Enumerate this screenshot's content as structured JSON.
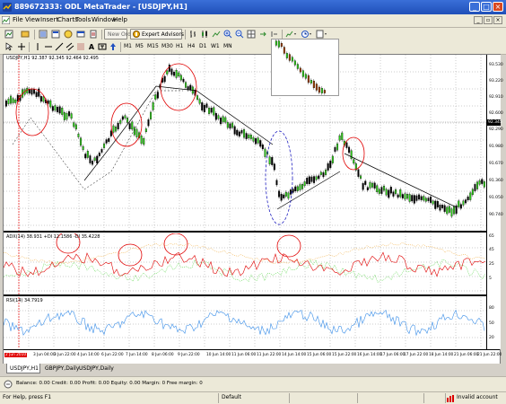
{
  "window": {
    "title": "889672333: ODL MetaTrader - [USDJPY,H1]",
    "buttons": [
      "_",
      "□",
      "×"
    ]
  },
  "menu": {
    "items": [
      "File",
      "View",
      "Insert",
      "Charts",
      "Tools",
      "Window",
      "Help"
    ]
  },
  "toolbar": {
    "new_order": "New Order",
    "expert_advisors": "Expert Advisors",
    "timeframes": [
      "M1",
      "M5",
      "M15",
      "M30",
      "H1",
      "H4",
      "D1",
      "W1",
      "MN"
    ]
  },
  "chart": {
    "main_label": "USDJPY,H1  92.387 92.345 92.464 92.495",
    "adx_label": "ADX(14) 38.931 +DI 12.1586 -DI 35.4228",
    "rsi_label": "RSI(14) 34.7919",
    "current_price": "92.345",
    "price_ticks": [
      "93.530",
      "93.220",
      "92.910",
      "92.600",
      "92.290",
      "91.980",
      "91.670",
      "91.360",
      "91.050",
      "90.740"
    ],
    "adx_ticks": [
      "65",
      "45",
      "25",
      "5"
    ],
    "rsi_ticks": [
      "80",
      "50",
      "20"
    ],
    "time_ticks": [
      "2 Jun 2010",
      "3 Jun 04:00",
      "3 Jun 22:00",
      "4 Jun 14:00",
      "6 Jun 22:00",
      "7 Jun 14:00",
      "8 Jun 06:00",
      "9 Jun 22:00",
      "10 Jun 14:00",
      "11 Jun 06:00",
      "11 Jun 22:00",
      "14 Jun 14:00",
      "15 Jun 06:00",
      "15 Jun 22:00",
      "16 Jun 14:00",
      "17 Jun 06:00",
      "17 Jun 22:00",
      "18 Jun 14:00",
      "21 Jun 06:00",
      "21 Jun 22:00",
      "22 Jun 14:00",
      "23 Jun 06:00",
      "23 Jun 22:00",
      "24 Jun 14:00",
      "25 Jun 06:00",
      "25 Jun 22:00"
    ]
  },
  "tabs": [
    "USDJPY,H1",
    "GBPJPY,Daily",
    "USDJPY,Daily"
  ],
  "terminal": {
    "text": "Balance: 0.00  Credit: 0.00  Profit: 0.00  Equity: 0.00  Margin: 0  Free margin: 0"
  },
  "statusbar": {
    "help": "For Help, press F1",
    "profile": "Default",
    "connection": "Invalid account"
  },
  "colors": {
    "bull": "#2ecc1a",
    "bear": "#000000",
    "annotation": "#e00000",
    "rsi_line": "#3a8ee8",
    "ellipse": "#2020c0"
  }
}
